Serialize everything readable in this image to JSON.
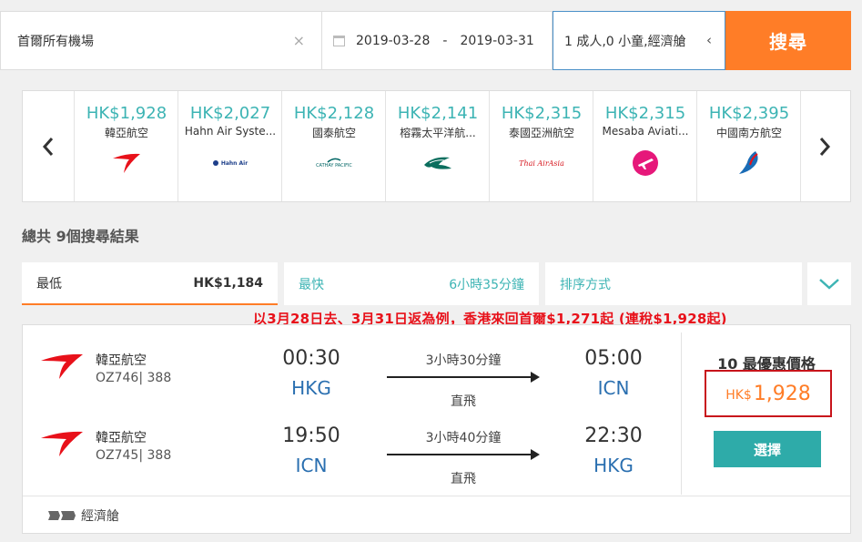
{
  "search": {
    "destination": "首爾所有機場",
    "clear_icon": "×",
    "date_from": "2019-03-28",
    "date_sep": "-",
    "date_to": "2019-03-31",
    "passengers": "1 成人,0 小童,經濟艙",
    "pax_chevron": "‹",
    "search_label": "搜尋"
  },
  "carousel": {
    "prev": "‹",
    "next": "›",
    "airlines": [
      {
        "price": "HK$1,928",
        "name": "韓亞航空",
        "logo": "asiana-logo"
      },
      {
        "price": "HK$2,027",
        "name": "Hahn Air Syste...",
        "logo": "hahn-air-logo",
        "logo_text": "Hahn Air"
      },
      {
        "price": "HK$2,128",
        "name": "國泰航空",
        "logo": "cathay-pacific-logo",
        "logo_text": "CATHAY PACIFIC"
      },
      {
        "price": "HK$2,141",
        "name": "榕霧太平洋航...",
        "logo": "cathay-dragon-logo"
      },
      {
        "price": "HK$2,315",
        "name": "泰國亞洲航空",
        "logo": "airasia-logo",
        "logo_text": "Thai AirAsia"
      },
      {
        "price": "HK$2,315",
        "name": "Mesaba Aviati...",
        "logo": "mesaba-logo"
      },
      {
        "price": "HK$2,395",
        "name": "中國南方航空",
        "logo": "china-southern-logo"
      }
    ]
  },
  "results": {
    "summary": "總共 9個搜尋結果"
  },
  "sort_tabs": {
    "cheapest_label": "最低",
    "cheapest_value": "HK$1,184",
    "fastest_label": "最快",
    "fastest_value": "6小時35分鐘",
    "sort_label": "排序方式",
    "expand_icon": "chevron-down-icon"
  },
  "promo": "以3月28日去、3月31日返為例，香港來回首爾$1,271起 (連稅$1,928起)",
  "card": {
    "legs": [
      {
        "airline": "韓亞航空",
        "flight": "OZ746| 388",
        "dep_time": "00:30",
        "dep_ap": "HKG",
        "duration": "3小時30分鐘",
        "stops": "直飛",
        "arr_time": "05:00",
        "arr_ap": "ICN"
      },
      {
        "airline": "韓亞航空",
        "flight": "OZ745| 388",
        "dep_time": "19:50",
        "dep_ap": "ICN",
        "duration": "3小時40分鐘",
        "stops": "直飛",
        "arr_time": "22:30",
        "arr_ap": "HKG"
      }
    ],
    "deal_label": "10 最優惠價格",
    "currency": "HK$",
    "price": "1,928",
    "select_label": "選擇",
    "cabin": "經濟艙"
  },
  "colors": {
    "accent": "#ff7d27",
    "teal": "#3db4b4",
    "button_teal": "#2eaba9",
    "promo_red": "#e8111a",
    "airport_blue": "#2a6fb0"
  }
}
